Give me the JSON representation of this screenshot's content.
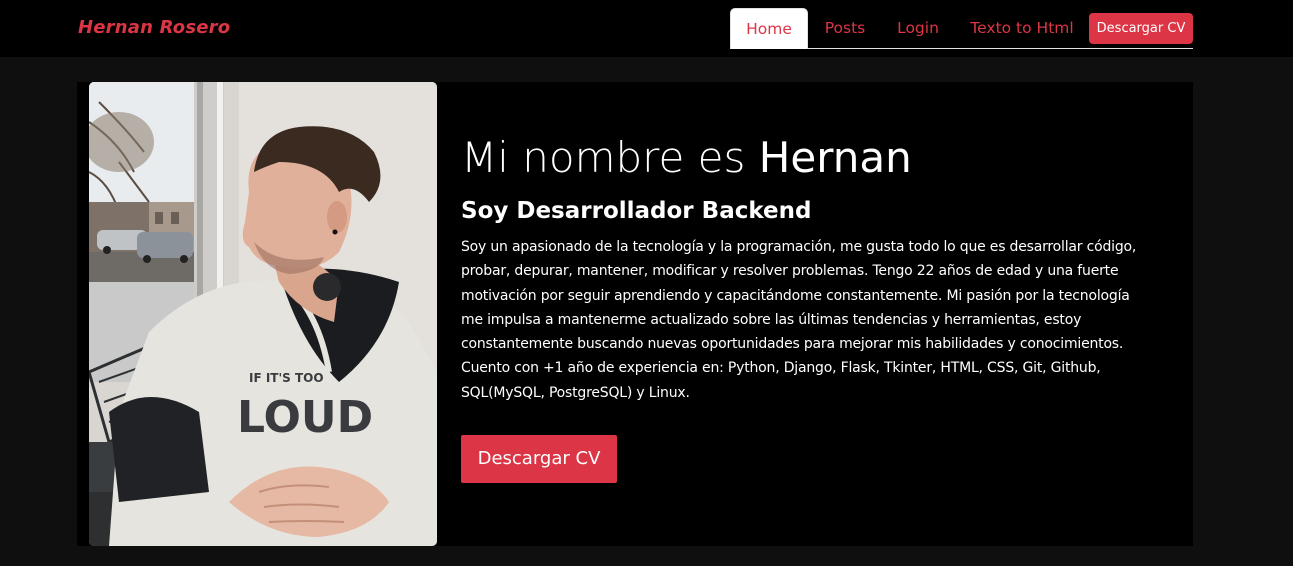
{
  "navbar": {
    "brand": "Hernan Rosero",
    "links": [
      {
        "label": "Home",
        "active": true
      },
      {
        "label": "Posts",
        "active": false
      },
      {
        "label": "Login",
        "active": false
      },
      {
        "label": "Texto to Html",
        "active": false
      }
    ],
    "cv_button": "Descargar CV"
  },
  "hero": {
    "title_prefix": "Mi nombre es ",
    "title_name": "Hernan",
    "subtitle": "Soy Desarrollador Backend",
    "bio_lines": [
      "Soy un apasionado de la tecnología y la programación, me gusta todo lo que es desarrollar código,",
      "probar, depurar, mantener, modificar y resolver problemas. Tengo 22 años de edad y una fuerte",
      "motivación por seguir aprendiendo y capacitándome constantemente. Mi pasión por la tecnología",
      "me impulsa a mantenerme actualizado sobre las últimas tendencias y herramientas, estoy",
      "constantemente buscando nuevas oportunidades para mejorar mis habilidades y conocimientos.",
      "Cuento con +1 año de experiencia en: Python, Django, Flask, Tkinter, HTML, CSS, Git, Github,",
      "SQL(MySQL, PostgreSQL) y Linux."
    ],
    "cv_button": "Descargar CV",
    "photo_hoodie_text": "LOUD",
    "photo_hoodie_small": "IF IT'S TOO"
  },
  "colors": {
    "accent": "#dc3545",
    "navbar_bg": "#000000",
    "page_bg": "#0f0f0f",
    "hero_bg": "#000000"
  }
}
